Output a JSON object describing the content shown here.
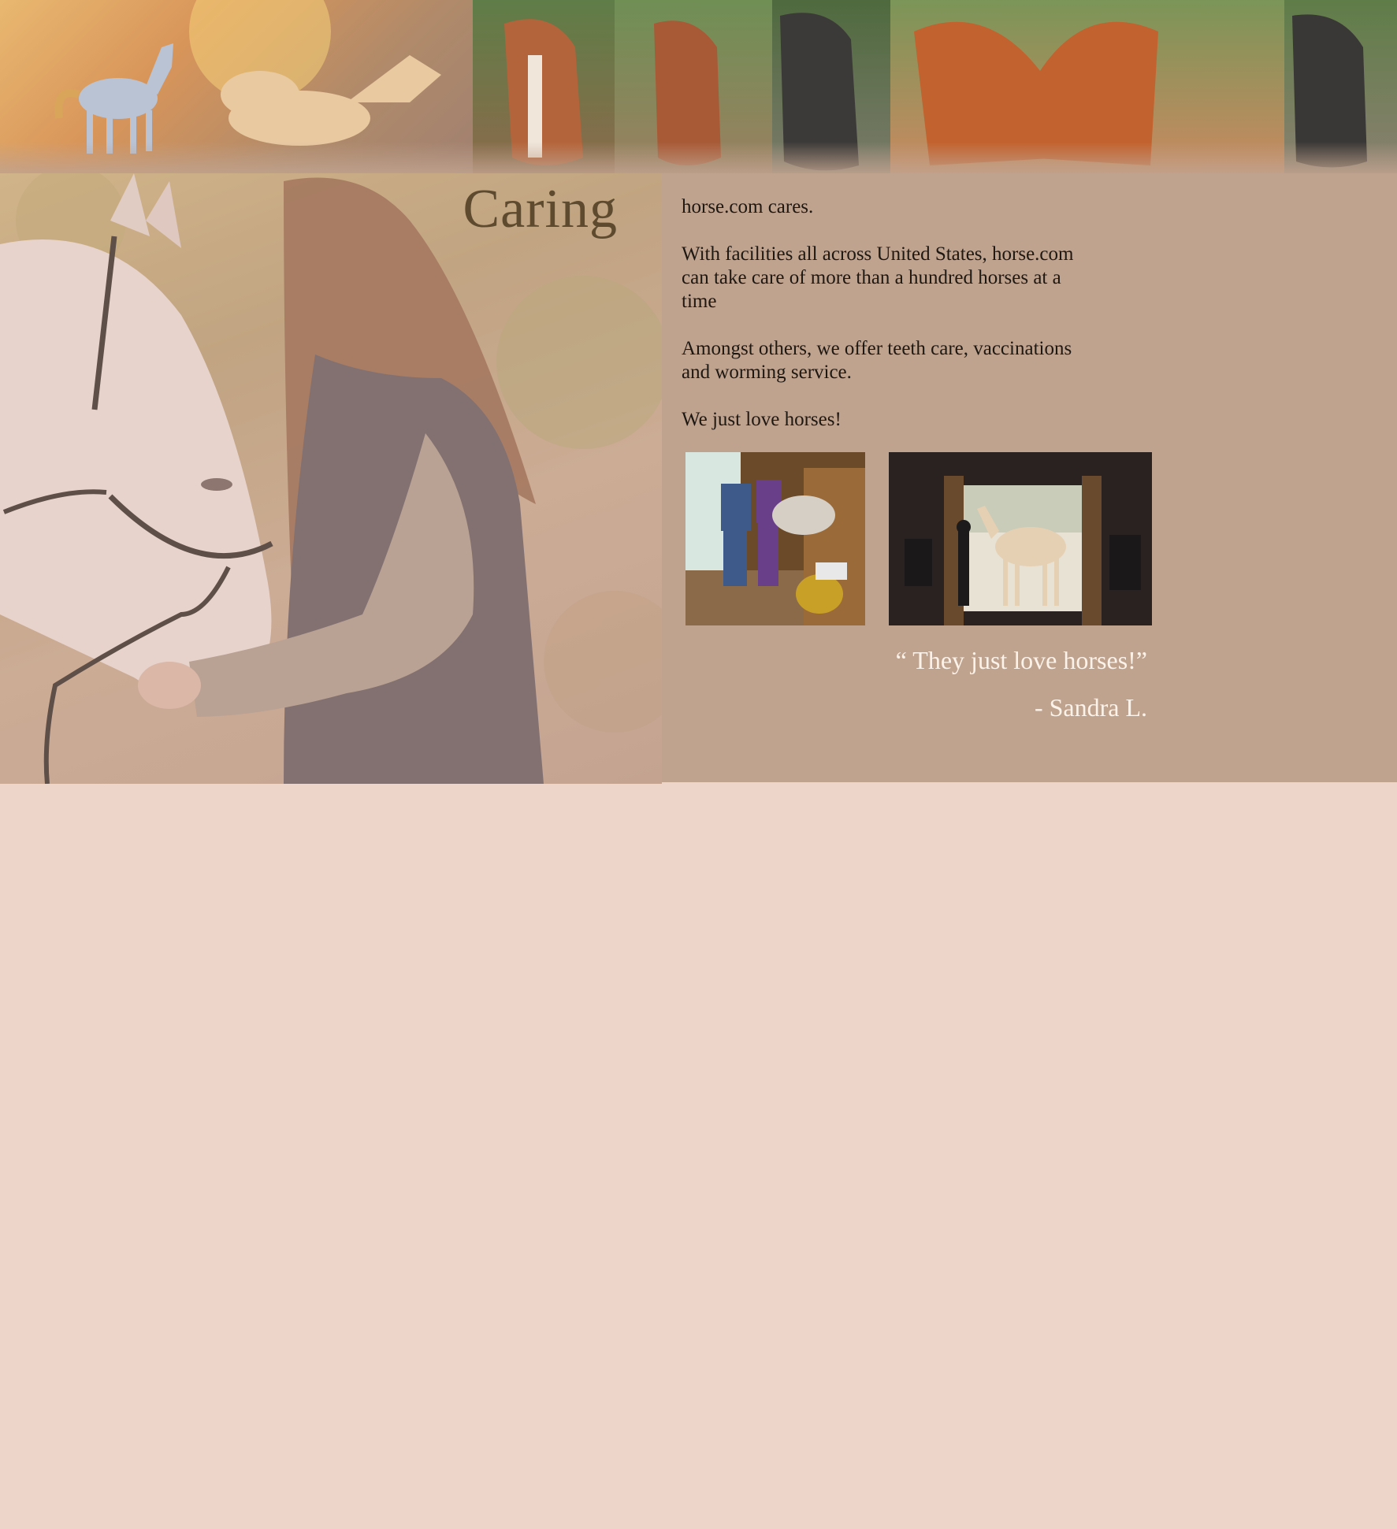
{
  "hero": {
    "title": "Caring"
  },
  "content": {
    "paragraphs": [
      "horse.com cares.",
      "With facilities all across United States, horse.com can take care of more than a hundred horses at a time",
      "Amongst others, we offer teeth care, vaccinations and worming service.",
      "We just love horses!"
    ]
  },
  "testimonial": {
    "quote": "“ They just love horses!”",
    "author": "- Sandra L."
  },
  "colors": {
    "page_background": "#eed5c9",
    "panel_background": "#c0a38f",
    "quote_text": "#fbf3ea",
    "title_text": "#5e4a2e"
  }
}
